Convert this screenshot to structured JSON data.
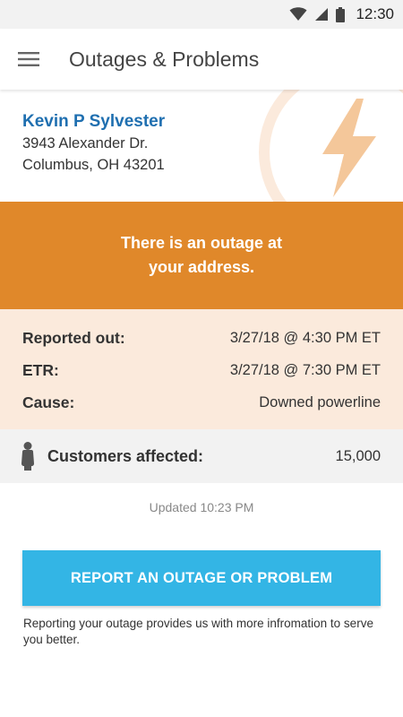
{
  "status_bar": {
    "time": "12:30",
    "icons": [
      "wifi-icon",
      "cell-signal-icon",
      "battery-icon"
    ]
  },
  "app_bar": {
    "title": "Outages & Problems",
    "menu_icon": "hamburger-menu-icon"
  },
  "account": {
    "name": "Kevin P Sylvester",
    "address_line1": "3943 Alexander Dr.",
    "address_line2": "Columbus, OH 43201",
    "background_icon": "lightning-bolt-icon"
  },
  "alert": {
    "message": "There is an outage at your address."
  },
  "details": {
    "reported_out_label": "Reported out:",
    "reported_out_value": "3/27/18 @ 4:30 PM ET",
    "etr_label": "ETR:",
    "etr_value": "3/27/18 @ 7:30 PM ET",
    "cause_label": "Cause:",
    "cause_value": "Downed powerline"
  },
  "customers": {
    "icon": "person-icon",
    "label": "Customers affected:",
    "value": "15,000"
  },
  "updated": "Updated 10:23 PM",
  "report_button": "REPORT AN OUTAGE OR PROBLEM",
  "report_note": "Reporting your outage provides us with more infromation to serve you better.",
  "colors": {
    "accent_blue": "#33b5e5",
    "name_blue": "#1f6fb0",
    "alert_orange": "#e0882a",
    "details_bg": "#fbeadc",
    "bolt_tint": "#f4c79a"
  }
}
